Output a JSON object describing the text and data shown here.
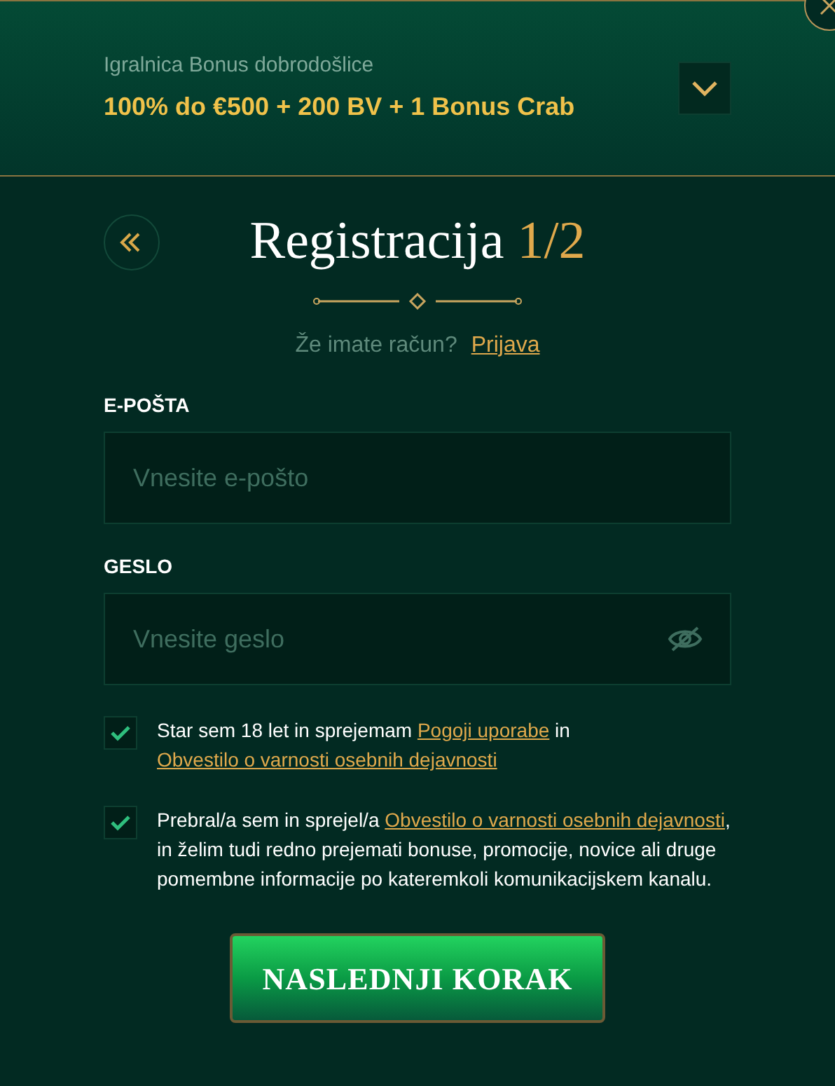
{
  "bonus": {
    "label": "Igralnica Bonus dobrodošlice",
    "offer": "100% do €500 + 200 BV + 1 Bonus Crab",
    "expanded": false
  },
  "title": {
    "text": "Registracija",
    "step": "1/2"
  },
  "login_prompt": {
    "text": "Že imate račun?",
    "link": "Prijava"
  },
  "fields": [
    {
      "label": "E-POŠTA",
      "placeholder": "Vnesite e-pošto",
      "kind": "email"
    },
    {
      "label": "GESLO",
      "placeholder": "Vnesite geslo",
      "kind": "password"
    }
  ],
  "consents": [
    {
      "checked": true,
      "segments": [
        {
          "kind": "text",
          "text": "Star sem 18 let in sprejemam "
        },
        {
          "kind": "link",
          "text": "Pogoji uporabe"
        },
        {
          "kind": "text",
          "text": " in "
        },
        {
          "kind": "link",
          "text": "Obvestilo o varnosti osebnih dejavnosti"
        }
      ]
    },
    {
      "checked": true,
      "segments": [
        {
          "kind": "text",
          "text": "Prebral/a sem in sprejel/a "
        },
        {
          "kind": "link",
          "text": "Obvestilo o varnosti osebnih dejavnosti"
        },
        {
          "kind": "text",
          "text": ", in želim tudi redno prejemati bonuse, promocije, novice ali druge pomembne informacije po kateremkoli komunikacijskem kanalu."
        }
      ]
    }
  ],
  "next_button": "NASLEDNJI KORAK"
}
